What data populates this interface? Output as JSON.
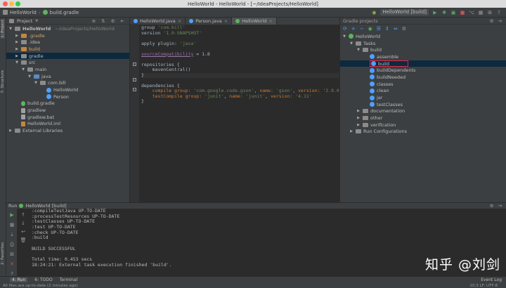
{
  "window": {
    "title": "HelloWorld - HelloWorld - [~/IdeaProjects/HelloWorld]"
  },
  "navbar": {
    "breadcrumbs": [
      "HelloWorld",
      "build.gradle"
    ],
    "run_config": "HelloWorld [build]"
  },
  "left_strip": {
    "tabs": [
      "1: Project",
      "7: Structure",
      "2: Favorites"
    ]
  },
  "project_panel": {
    "header": "Project",
    "tree": [
      {
        "indent": 0,
        "arrow": "▼",
        "icon": "folder-module",
        "label": "HelloWorld",
        "hint": "~/IdeaProjects/HelloWorld",
        "bold": true
      },
      {
        "indent": 1,
        "arrow": "▶",
        "icon": "folder-orange",
        "label": ".gradle"
      },
      {
        "indent": 1,
        "arrow": "▶",
        "icon": "folder",
        "label": ".idea"
      },
      {
        "indent": 1,
        "arrow": "▶",
        "icon": "folder-orange",
        "label": "build"
      },
      {
        "indent": 1,
        "arrow": "▶",
        "icon": "folder",
        "label": "gradle",
        "selected": true
      },
      {
        "indent": 1,
        "arrow": "▼",
        "icon": "folder",
        "label": "src"
      },
      {
        "indent": 2,
        "arrow": "▼",
        "icon": "folder",
        "label": "main"
      },
      {
        "indent": 3,
        "arrow": "▼",
        "icon": "folder-blue",
        "label": "java"
      },
      {
        "indent": 4,
        "arrow": "▼",
        "icon": "package",
        "label": "com.bill"
      },
      {
        "indent": 5,
        "arrow": "",
        "icon": "class",
        "label": "HelloWorld"
      },
      {
        "indent": 5,
        "arrow": "",
        "icon": "class",
        "label": "Person"
      },
      {
        "indent": 1,
        "arrow": "",
        "icon": "gradle-file",
        "label": "build.gradle"
      },
      {
        "indent": 1,
        "arrow": "",
        "icon": "file",
        "label": "gradlew"
      },
      {
        "indent": 1,
        "arrow": "",
        "icon": "file",
        "label": "gradlew.bat"
      },
      {
        "indent": 1,
        "arrow": "",
        "icon": "iml-file",
        "label": "HelloWorld.iml"
      },
      {
        "indent": 0,
        "arrow": "▶",
        "icon": "library",
        "label": "External Libraries"
      }
    ]
  },
  "editor": {
    "tabs": [
      {
        "label": "HelloWorld.java",
        "icon": "class",
        "active": false
      },
      {
        "label": "Person.java",
        "icon": "class",
        "active": false
      },
      {
        "label": "HelloWorld",
        "icon": "gradle-file",
        "active": true
      }
    ],
    "lines": [
      "group 'com.bill'",
      "version '1.0-SNAPSHOT'",
      "",
      "apply plugin: 'java'",
      "",
      "sourceCompatibility = 1.8",
      "",
      "repositories {",
      "    mavenCentral()",
      "}",
      "",
      "dependencies {",
      "    compile group: 'com.google.code.gson', name: 'gson', version: '2.8.0'",
      "    testCompile group: 'junit', name: 'junit', version: '4.11'",
      "}"
    ]
  },
  "gradle_panel": {
    "header": "Gradle projects",
    "tree": [
      {
        "indent": 0,
        "arrow": "▼",
        "icon": "gradle",
        "label": "HelloWorld"
      },
      {
        "indent": 1,
        "arrow": "▼",
        "icon": "folder",
        "label": "Tasks"
      },
      {
        "indent": 2,
        "arrow": "▼",
        "icon": "folder",
        "label": "build"
      },
      {
        "indent": 3,
        "arrow": "",
        "icon": "gear",
        "label": "assemble"
      },
      {
        "indent": 3,
        "arrow": "",
        "icon": "gear",
        "label": "build",
        "highlighted": true
      },
      {
        "indent": 3,
        "arrow": "",
        "icon": "gear",
        "label": "buildDependents"
      },
      {
        "indent": 3,
        "arrow": "",
        "icon": "gear",
        "label": "buildNeeded"
      },
      {
        "indent": 3,
        "arrow": "",
        "icon": "gear",
        "label": "classes"
      },
      {
        "indent": 3,
        "arrow": "",
        "icon": "gear",
        "label": "clean"
      },
      {
        "indent": 3,
        "arrow": "",
        "icon": "gear",
        "label": "jar"
      },
      {
        "indent": 3,
        "arrow": "",
        "icon": "gear",
        "label": "testClasses"
      },
      {
        "indent": 2,
        "arrow": "▶",
        "icon": "folder",
        "label": "documentation"
      },
      {
        "indent": 2,
        "arrow": "▶",
        "icon": "folder",
        "label": "other"
      },
      {
        "indent": 2,
        "arrow": "▶",
        "icon": "folder",
        "label": "verification"
      },
      {
        "indent": 1,
        "arrow": "▶",
        "icon": "folder",
        "label": "Run Configurations"
      }
    ]
  },
  "run_panel": {
    "header": "Run",
    "config": "HelloWorld [build]",
    "console": [
      ":compileTestJava UP-TO-DATE",
      ":processTestResources UP-TO-DATE",
      ":testClasses UP-TO-DATE",
      ":test UP-TO-DATE",
      ":check UP-TO-DATE",
      ":build",
      "",
      "BUILD SUCCESSFUL",
      "",
      "Total time: 0.453 secs",
      "18:24:21: External task execution finished 'build'."
    ]
  },
  "bottom_tabs": [
    "4: Run",
    "6: TODO",
    "Terminal"
  ],
  "event_log": "Event Log",
  "status": {
    "message": "All files are up-to-date (2 minutes ago)",
    "right": "10:3  LF:  UTF-8"
  },
  "watermark": "知乎 @刘剑",
  "colors": {
    "accent_blue": "#4fa0ff",
    "gradle_green": "#5db45d",
    "highlight_red": "#e2264d",
    "selection": "#0d293e"
  }
}
